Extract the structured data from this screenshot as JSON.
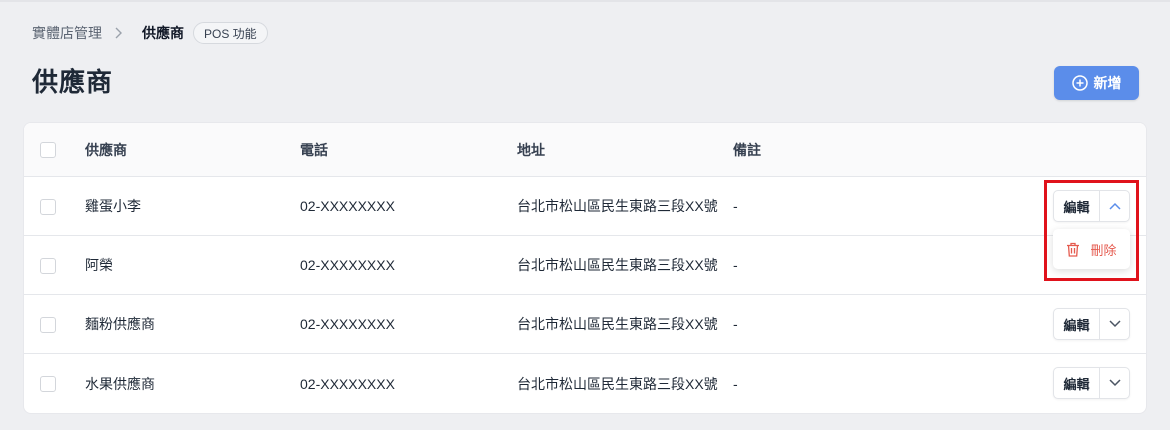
{
  "breadcrumb": {
    "parent": "實體店管理",
    "current": "供應商",
    "badge": "POS 功能"
  },
  "page": {
    "title": "供應商",
    "add_label": "新增"
  },
  "table": {
    "headers": [
      "供應商",
      "電話",
      "地址",
      "備註"
    ],
    "rows": [
      {
        "name": "雞蛋小李",
        "phone": "02-XXXXXXXX",
        "address": "台北市松山區民生東路三段XX號",
        "note": "-",
        "edit": "編輯"
      },
      {
        "name": "阿榮",
        "phone": "02-XXXXXXXX",
        "address": "台北市松山區民生東路三段XX號",
        "note": "-",
        "edit": "編輯"
      },
      {
        "name": "麵粉供應商",
        "phone": "02-XXXXXXXX",
        "address": "台北市松山區民生東路三段XX號",
        "note": "-",
        "edit": "編輯"
      },
      {
        "name": "水果供應商",
        "phone": "02-XXXXXXXX",
        "address": "台北市松山區民生東路三段XX號",
        "note": "-",
        "edit": "編輯"
      }
    ]
  },
  "dropdown": {
    "delete_label": "刪除"
  },
  "icons": {
    "add": "plus-circle-icon",
    "chevron_up": "chevron-up-icon",
    "chevron_down": "chevron-down-icon",
    "trash": "trash-icon",
    "breadcrumb_sep": "chevron-right-icon"
  },
  "colors": {
    "primary": "#5b8dea",
    "danger": "#e55a4e",
    "highlight": "#e0121b"
  }
}
